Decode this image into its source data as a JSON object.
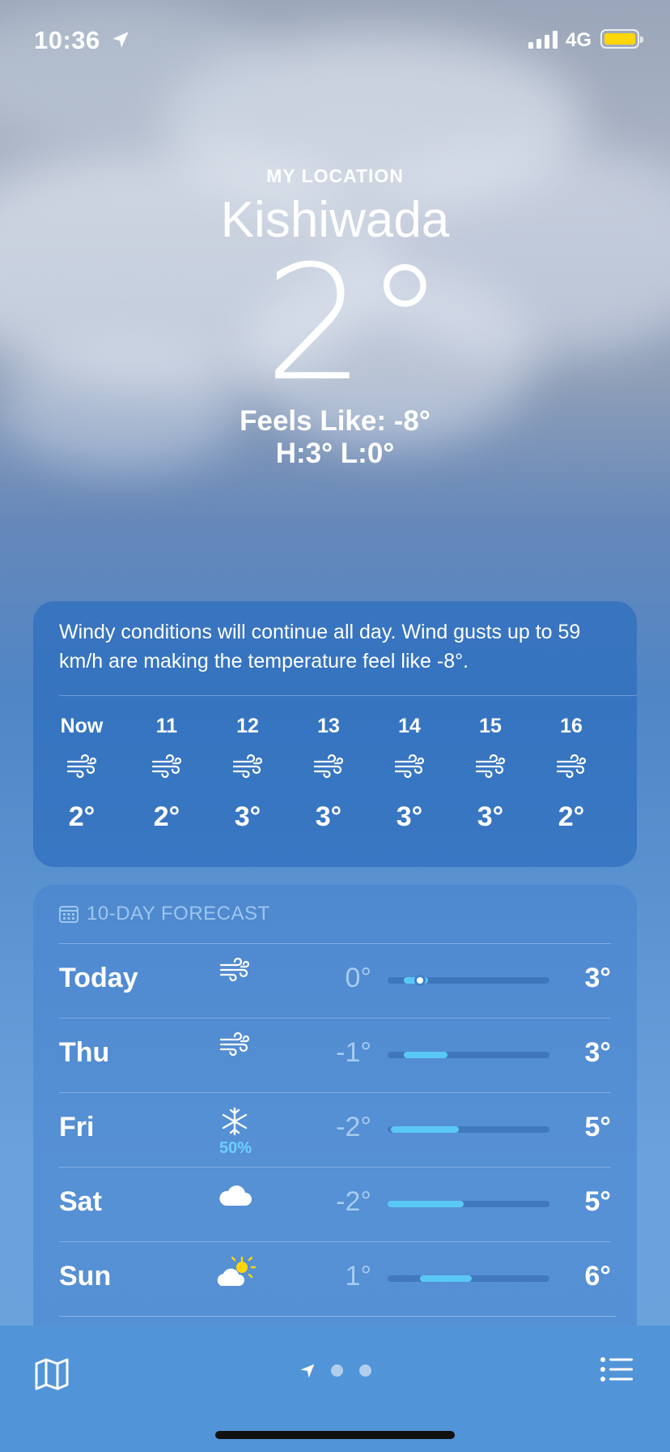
{
  "status_bar": {
    "time": "10:36",
    "network": "4G",
    "battery_color": "#ffd60a"
  },
  "header": {
    "location_label": "MY LOCATION",
    "city": "Kishiwada",
    "temperature": "2°",
    "feels_like": "Feels Like: -8°",
    "high_low": "H:3°  L:0°"
  },
  "hourly": {
    "summary": "Windy conditions will continue all day. Wind gusts up to 59 km/h are making the temperature feel like -8°.",
    "hours": [
      {
        "label": "Now",
        "icon": "wind-icon",
        "temp": "2°"
      },
      {
        "label": "11",
        "icon": "wind-icon",
        "temp": "2°"
      },
      {
        "label": "12",
        "icon": "wind-icon",
        "temp": "3°"
      },
      {
        "label": "13",
        "icon": "wind-icon",
        "temp": "3°"
      },
      {
        "label": "14",
        "icon": "wind-icon",
        "temp": "3°"
      },
      {
        "label": "15",
        "icon": "wind-icon",
        "temp": "3°"
      },
      {
        "label": "16",
        "icon": "wind-icon",
        "temp": "2°"
      }
    ]
  },
  "forecast": {
    "title": "10-DAY FORECAST",
    "days": [
      {
        "day": "Today",
        "icon": "wind-icon",
        "precip": "",
        "low": "0°",
        "high": "3°",
        "range_start": 0.1,
        "range_end": 0.25,
        "current": 0.2
      },
      {
        "day": "Thu",
        "icon": "wind-icon",
        "precip": "",
        "low": "-1°",
        "high": "3°",
        "range_start": 0.1,
        "range_end": 0.37
      },
      {
        "day": "Fri",
        "icon": "snowflake-icon",
        "precip": "50%",
        "low": "-2°",
        "high": "5°",
        "range_start": 0.02,
        "range_end": 0.44
      },
      {
        "day": "Sat",
        "icon": "cloud-icon",
        "precip": "",
        "low": "-2°",
        "high": "5°",
        "range_start": 0.0,
        "range_end": 0.47
      },
      {
        "day": "Sun",
        "icon": "partly-sunny-icon",
        "precip": "",
        "low": "1°",
        "high": "6°",
        "range_start": 0.2,
        "range_end": 0.52
      }
    ]
  },
  "tab_bar": {
    "icons": [
      "map-icon",
      "location-arrow-icon",
      "page-dot-icon",
      "list-icon"
    ]
  }
}
